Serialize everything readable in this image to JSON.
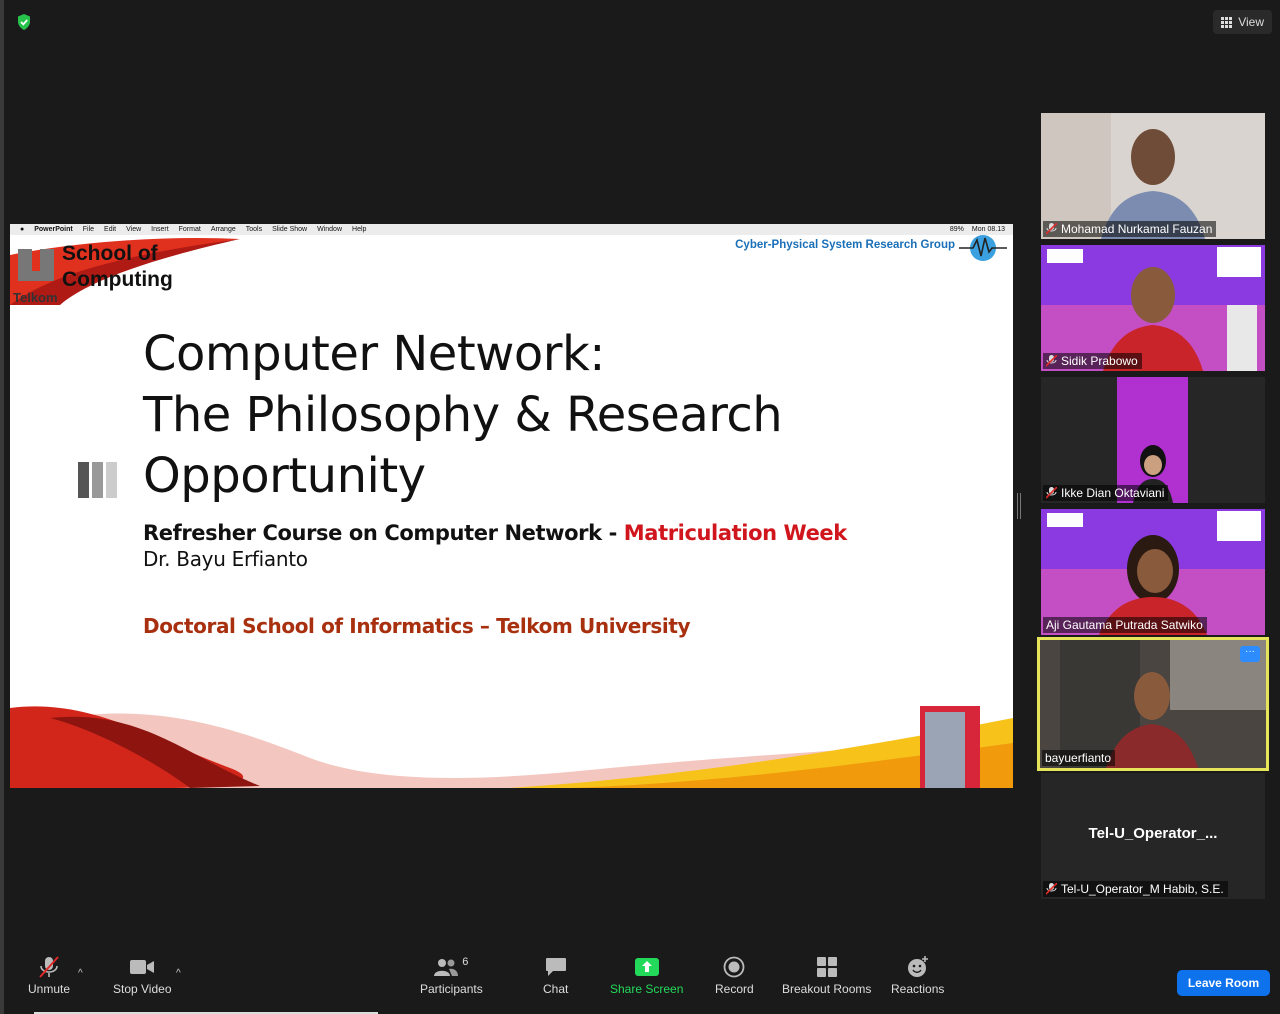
{
  "toolbar_top": {
    "view_label": "View"
  },
  "slide": {
    "menubar": {
      "app": "PowerPoint",
      "items": [
        "File",
        "Edit",
        "View",
        "Insert",
        "Format",
        "Arrange",
        "Tools",
        "Slide Show",
        "Window",
        "Help"
      ],
      "battery": "89%",
      "clock": "Mon 08.13"
    },
    "logo_school_1": "School of",
    "logo_school_2": "Computing",
    "logo_telkom": "Telkom",
    "research_group": "Cyber-Physical System Research Group",
    "title_line1": "Computer Network:",
    "title_line2": "The Philosophy & Research",
    "title_line3": "Opportunity",
    "subtitle_main": "Refresher Course on Computer Network - ",
    "subtitle_red": "Matriculation Week",
    "presenter": "Dr. Bayu Erfianto",
    "school": "Doctoral School of Informatics – Telkom University"
  },
  "participants": [
    {
      "name": "Mohamad Nurkamal Fauzan",
      "muted": true
    },
    {
      "name": "Sidik Prabowo",
      "muted": true
    },
    {
      "name": "Ikke Dian Oktaviani",
      "muted": true
    },
    {
      "name": "Aji Gautama Putrada Satwiko",
      "muted": false
    },
    {
      "name": "bayuerfianto",
      "muted": false,
      "active_speaker": true,
      "more_label": "···"
    },
    {
      "name": "Tel-U_Operator_M Habib, S.E.",
      "display_title": "Tel-U_Operator_...",
      "muted": true
    }
  ],
  "toolbar": {
    "unmute": "Unmute",
    "stop_video": "Stop Video",
    "participants": "Participants",
    "participants_count": "6",
    "chat": "Chat",
    "share_screen": "Share Screen",
    "record": "Record",
    "breakout_rooms": "Breakout Rooms",
    "reactions": "Reactions",
    "leave_room": "Leave Room"
  },
  "colors": {
    "accent_blue": "#0e72ed",
    "share_green": "#23d959",
    "active_border": "#e6e45a",
    "slide_red": "#d0151c"
  }
}
